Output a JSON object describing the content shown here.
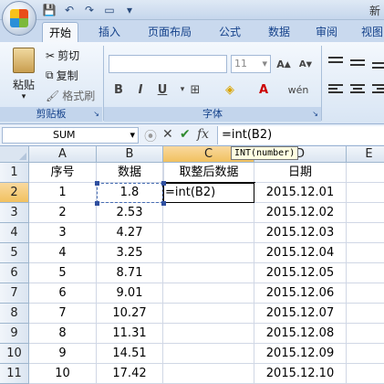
{
  "titlebar": {
    "title_fragment": "新"
  },
  "tabs": [
    {
      "label": "开始",
      "active": true
    },
    {
      "label": "插入"
    },
    {
      "label": "页面布局"
    },
    {
      "label": "公式"
    },
    {
      "label": "数据"
    },
    {
      "label": "审阅"
    },
    {
      "label": "视图"
    }
  ],
  "ribbon": {
    "clipboard": {
      "paste": "粘贴",
      "cut": "剪切",
      "copy": "复制",
      "format_painter": "格式刷",
      "group_label": "剪贴板"
    },
    "font": {
      "size": "11",
      "group_label": "字体"
    }
  },
  "formula_bar": {
    "name_box": "SUM",
    "fx": "fx",
    "formula": "=int(B2)"
  },
  "tooltip": "INT(number)",
  "sheet": {
    "columns": [
      "A",
      "B",
      "C",
      "D",
      "E"
    ],
    "rows": [
      {
        "num": "1",
        "a": "序号",
        "b": "数据",
        "c": "取整后数据",
        "d": "日期"
      },
      {
        "num": "2",
        "a": "1",
        "b": "1.8",
        "c": "=int(B2)",
        "d": "2015.12.01"
      },
      {
        "num": "3",
        "a": "2",
        "b": "2.53",
        "c": "",
        "d": "2015.12.02"
      },
      {
        "num": "4",
        "a": "3",
        "b": "4.27",
        "c": "",
        "d": "2015.12.03"
      },
      {
        "num": "5",
        "a": "4",
        "b": "3.25",
        "c": "",
        "d": "2015.12.04"
      },
      {
        "num": "6",
        "a": "5",
        "b": "8.71",
        "c": "",
        "d": "2015.12.05"
      },
      {
        "num": "7",
        "a": "6",
        "b": "9.01",
        "c": "",
        "d": "2015.12.06"
      },
      {
        "num": "8",
        "a": "7",
        "b": "10.27",
        "c": "",
        "d": "2015.12.07"
      },
      {
        "num": "9",
        "a": "8",
        "b": "11.31",
        "c": "",
        "d": "2015.12.08"
      },
      {
        "num": "10",
        "a": "9",
        "b": "14.51",
        "c": "",
        "d": "2015.12.09"
      },
      {
        "num": "11",
        "a": "10",
        "b": "17.42",
        "c": "",
        "d": "2015.12.10"
      }
    ]
  }
}
